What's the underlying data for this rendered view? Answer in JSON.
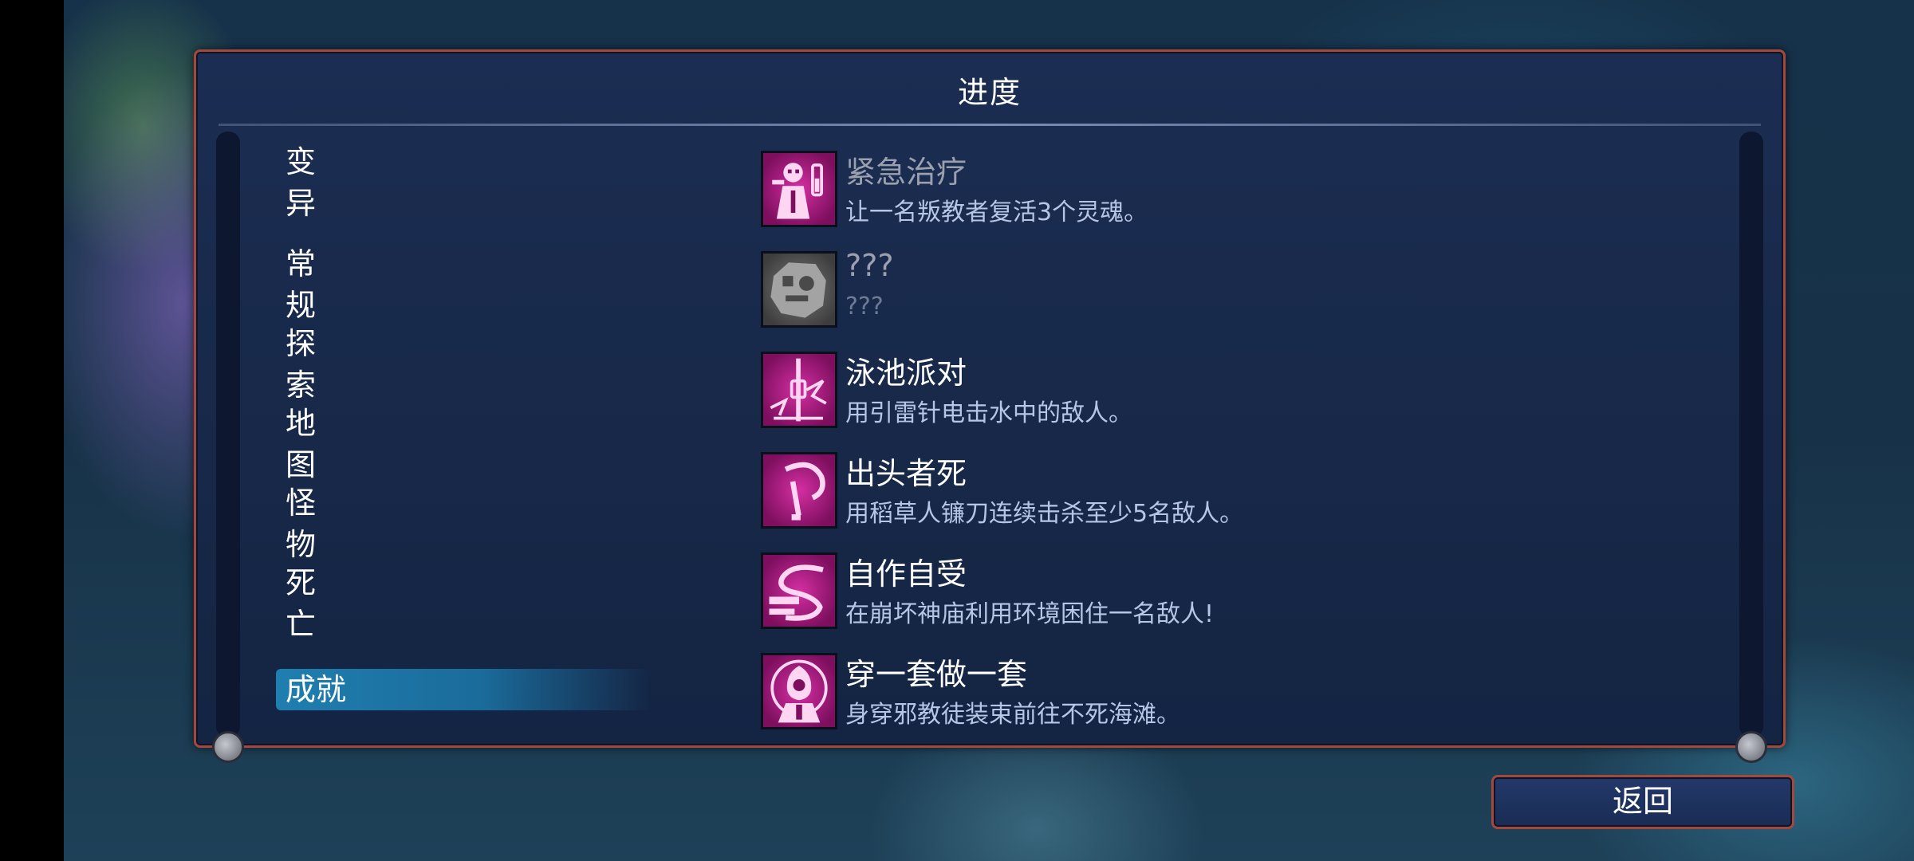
{
  "window": {
    "title": "进度"
  },
  "categories": [
    {
      "label": "变异"
    },
    {
      "label": "常规"
    },
    {
      "label": "探索"
    },
    {
      "label": "地图"
    },
    {
      "label": "怪物"
    },
    {
      "label": "死亡"
    },
    {
      "label": "成就",
      "selected": true
    }
  ],
  "achievements": [
    {
      "icon": "healer-ghost-icon",
      "title": "紧急治疗",
      "description": "让一名叛教者复活3个灵魂。",
      "unlocked": true
    },
    {
      "icon": "locked-achievement-icon",
      "title": "???",
      "description": "???",
      "unlocked": false
    },
    {
      "icon": "lightning-rod-icon",
      "title": "泳池派对",
      "description": "用引雷针电击水中的敌人。",
      "unlocked": true
    },
    {
      "icon": "sickle-icon",
      "title": "出头者死",
      "description": "用稻草人镰刀连续击杀至少5名敌人。",
      "unlocked": true
    },
    {
      "icon": "trap-whip-icon",
      "title": "自作自受",
      "description": "在崩坏神庙利用环境困住一名敌人!",
      "unlocked": true
    },
    {
      "icon": "hooded-cultist-icon",
      "title": "穿一套做一套",
      "description": "身穿邪教徒装束前往不死海滩。",
      "unlocked": true
    }
  ],
  "buttons": {
    "back_label": "返回"
  },
  "colors": {
    "accent_pink": "#d42fa2",
    "frame_border": "#a4483c",
    "selected_tab": "#1f7fb0"
  }
}
